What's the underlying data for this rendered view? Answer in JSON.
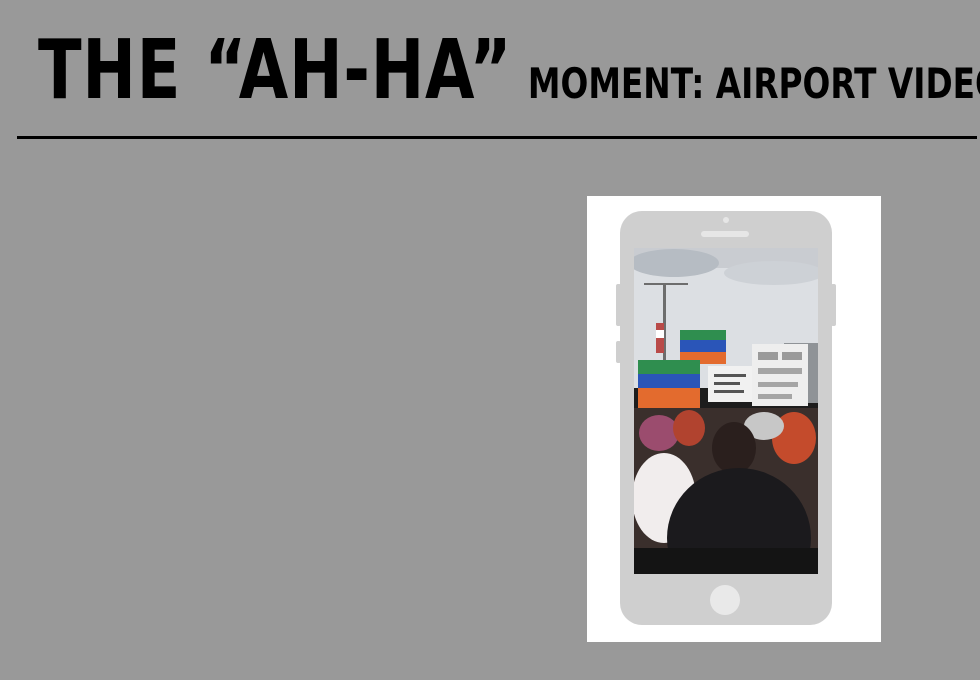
{
  "slide": {
    "title_main": "THE “AH-HA”",
    "title_sub": "MOMENT: AIRPORT VIDEOS"
  },
  "colors": {
    "background": "#999999",
    "title_text": "#000000",
    "rule": "#000000",
    "card": "#ffffff",
    "phone_body": "#cfcfcf"
  },
  "media": {
    "device": "smartphone",
    "content": "video-frame"
  }
}
